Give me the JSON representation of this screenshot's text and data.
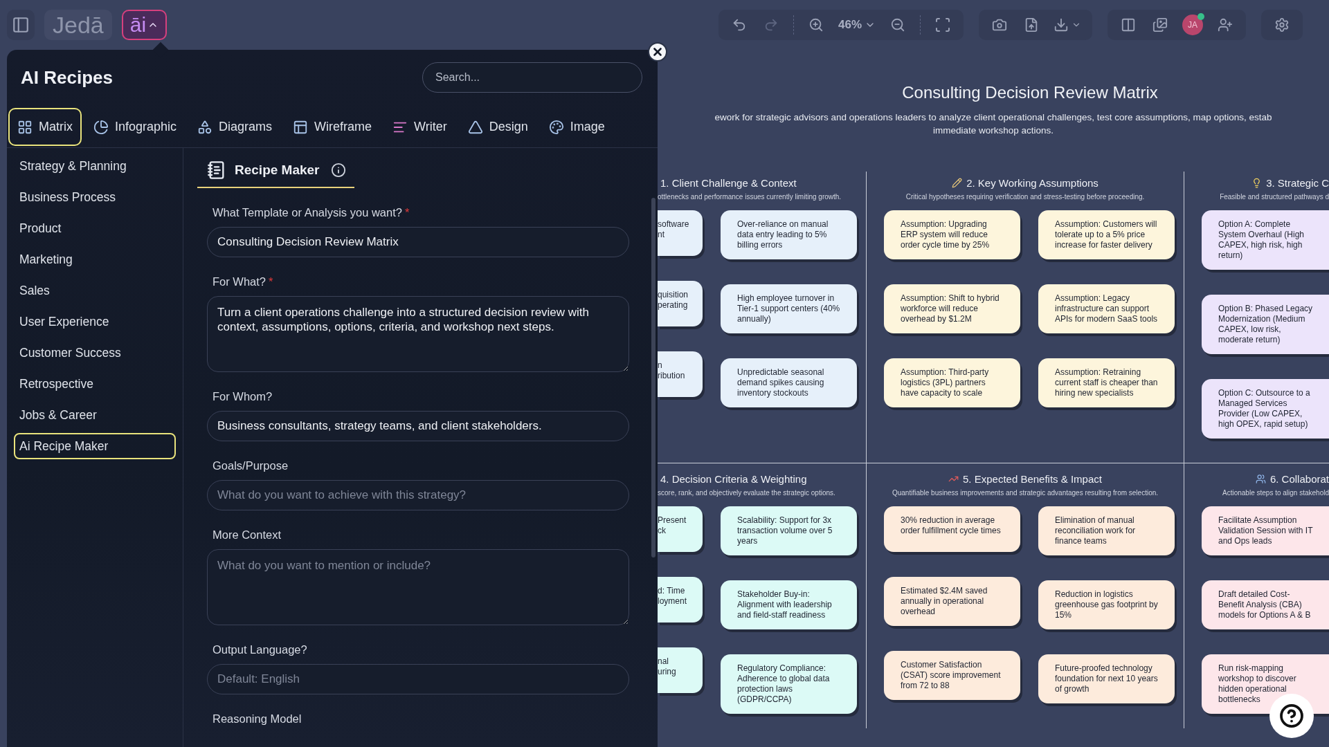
{
  "topbar": {
    "logo": "Jedā",
    "ai_button": {
      "label": "āi",
      "expanded": true
    },
    "zoom": "46%",
    "avatar": "JA"
  },
  "panel": {
    "title": "AI Recipes",
    "search": {
      "placeholder": "Search..."
    },
    "tabs": [
      {
        "label": "Matrix",
        "selected": true
      },
      {
        "label": "Infographic",
        "selected": false
      },
      {
        "label": "Diagrams",
        "selected": false
      },
      {
        "label": "Wireframe",
        "selected": false
      },
      {
        "label": "Writer",
        "selected": false
      },
      {
        "label": "Design",
        "selected": false
      },
      {
        "label": "Image",
        "selected": false
      }
    ],
    "categories": [
      {
        "label": "Strategy & Planning",
        "selected": false
      },
      {
        "label": "Business Process",
        "selected": false
      },
      {
        "label": "Product",
        "selected": false
      },
      {
        "label": "Marketing",
        "selected": false
      },
      {
        "label": "Sales",
        "selected": false
      },
      {
        "label": "User Experience",
        "selected": false
      },
      {
        "label": "Customer Success",
        "selected": false
      },
      {
        "label": "Retrospective",
        "selected": false
      },
      {
        "label": "Jobs & Career",
        "selected": false
      },
      {
        "label": "Ai Recipe Maker",
        "selected": true
      }
    ],
    "form": {
      "tab": "Recipe Maker",
      "fields": [
        {
          "label": "What Template or Analysis you want?",
          "required_mark": "*",
          "kind": "input",
          "value": "Consulting Decision Review Matrix"
        },
        {
          "label": "For What?",
          "required_mark": "*",
          "kind": "textarea",
          "value": "Turn a client operations challenge into a structured decision review with context, assumptions, options, criteria, and workshop next steps."
        },
        {
          "label": "For Whom?",
          "kind": "input",
          "value": "Business consultants, strategy teams, and client stakeholders."
        },
        {
          "label": "Goals/Purpose",
          "kind": "input",
          "placeholder": "What do you want to achieve with this strategy?"
        },
        {
          "label": "More Context",
          "kind": "textarea",
          "placeholder": "What do you want to mention or include?"
        },
        {
          "label": "Output Language?",
          "kind": "input",
          "placeholder": "Default: English"
        }
      ],
      "trailing_label": "Reasoning Model"
    }
  },
  "canvas": {
    "title": "Consulting Decision Review Matrix",
    "subtitle": "ework for strategic advisors and operations leaders to analyze client operational challenges, test core assumptions, map options, estab\nimmediate workshop actions.",
    "sections": [
      {
        "heading": "1. Client Challenge & Context",
        "description": "ottlenecks and performance issues currently limiting growth.",
        "color": "#e6f0fa",
        "columns": [
          {
            "kind": "cut_left",
            "cards": [
              "software\nnt",
              "quisition\nperating",
              "n\nribution"
            ]
          },
          {
            "kind": "full",
            "cards": [
              "Over-reliance on manual data entry leading to 5% billing errors",
              "High employee turnover in Tier-1 support centers (40% annually)",
              "Unpredictable seasonal demand spikes causing inventory stockouts"
            ]
          }
        ]
      },
      {
        "heading": "2. Key Working Assumptions",
        "description": "Critical hypotheses requiring verification and stress-testing before proceeding.",
        "color": "#fdf5dc",
        "columns": [
          {
            "kind": "full",
            "cards": [
              "Assumption: Upgrading ERP system will reduce order cycle time by 25%",
              "Assumption: Shift to hybrid workforce will reduce overhead by $1.2M",
              "Assumption: Third-party logistics (3PL) partners have capacity to scale"
            ]
          },
          {
            "kind": "full",
            "cards": [
              "Assumption: Customers will tolerate up to a 5% price increase for faster delivery",
              "Assumption: Legacy infrastructure can support APIs for modern SaaS tools",
              "Assumption: Retraining current staff is cheaper than hiring new specialists"
            ]
          }
        ]
      },
      {
        "heading": "3. Strategic C",
        "description": "Feasible and structured pathways d",
        "color": "#ece4fb",
        "columns": [
          {
            "kind": "cut_right",
            "cards": [
              "Option A: Complete System Overhaul (High CAPEX, high risk, high return)",
              "Option B: Phased Legacy Modernization (Medium CAPEX, low risk, moderate return)",
              "Option C: Outsource to a Managed Services Provider (Low CAPEX, high OPEX, rapid setup)"
            ]
          }
        ]
      },
      {
        "heading": "4. Decision Criteria & Weighting",
        "description": "score, rank, and objectively evaluate the strategic options.",
        "color": "#dcfaf6",
        "columns": [
          {
            "kind": "cut_left",
            "cards": [
              "Present\nck",
              "d: Time\nloyment",
              "nal\nuring"
            ]
          },
          {
            "kind": "full",
            "cards": [
              "Scalability: Support for 3x transaction volume over 5 years",
              "Stakeholder Buy-in: Alignment with leadership and field-staff readiness",
              "Regulatory Compliance: Adherence to global data protection laws (GDPR/CCPA)"
            ]
          }
        ]
      },
      {
        "heading": "5. Expected Benefits & Impact",
        "description": "Quantifiable business improvements and strategic advantages resulting from selection.",
        "color": "#fdebdc",
        "columns": [
          {
            "kind": "full",
            "cards": [
              "30% reduction in average order fulfillment cycle times",
              "Estimated $2.4M saved annually in operational overhead",
              "Customer Satisfaction (CSAT) score improvement from 72 to 88"
            ]
          },
          {
            "kind": "full",
            "cards": [
              "Elimination of manual reconciliation work for finance teams",
              "Reduction in logistics greenhouse gas footprint by 15%",
              "Future-proofed technology foundation for next 10 years of growth"
            ]
          }
        ]
      },
      {
        "heading": "6. Collaborat",
        "description": "Actionable steps to align stakehold",
        "color": "#fde6ea",
        "columns": [
          {
            "kind": "cut_right",
            "cards": [
              "Facilitate Assumption Validation Session with IT and Ops leads",
              "Draft detailed Cost-Benefit Analysis (CBA) models for Options A & B",
              "Run risk-mapping workshop to discover hidden operational bottlenecks"
            ]
          }
        ]
      }
    ]
  }
}
